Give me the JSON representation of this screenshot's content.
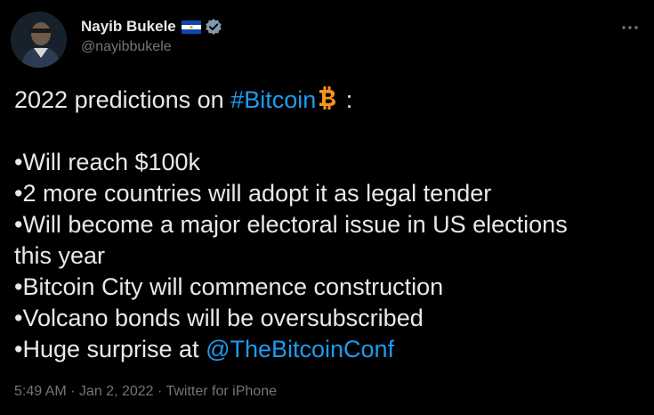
{
  "author": {
    "display_name": "Nayib Bukele",
    "handle": "@nayibbukele"
  },
  "icons": {
    "flag": "el-salvador-flag-icon",
    "verified": "verified-badge-icon",
    "more": "more-options-icon",
    "bitcoin": "bitcoin-emoji-icon"
  },
  "tweet": {
    "line1_prefix": "2022 predictions on ",
    "hashtag": "#Bitcoin",
    "line1_suffix": " :",
    "bullet1": "•Will reach $100k",
    "bullet2": "•2 more countries will adopt it as legal tender",
    "bullet3_line1": "•Will become a major electoral issue in US elections",
    "bullet3_line2": "this year",
    "bullet4": "•Bitcoin City will commence construction",
    "bullet5": "•Volcano bonds will be oversubscribed",
    "bullet6_prefix": "•Huge surprise at ",
    "mention": "@TheBitcoinConf"
  },
  "meta": {
    "time": "5:49 AM",
    "sep1": " · ",
    "date": "Jan 2, 2022",
    "sep2": " · ",
    "source": "Twitter for iPhone"
  },
  "colors": {
    "background": "#000000",
    "text": "#e7e9ea",
    "secondary": "#71767b",
    "link": "#1d9bf0",
    "bitcoin_orange": "#f7931a",
    "verified_gray": "#829aab"
  }
}
